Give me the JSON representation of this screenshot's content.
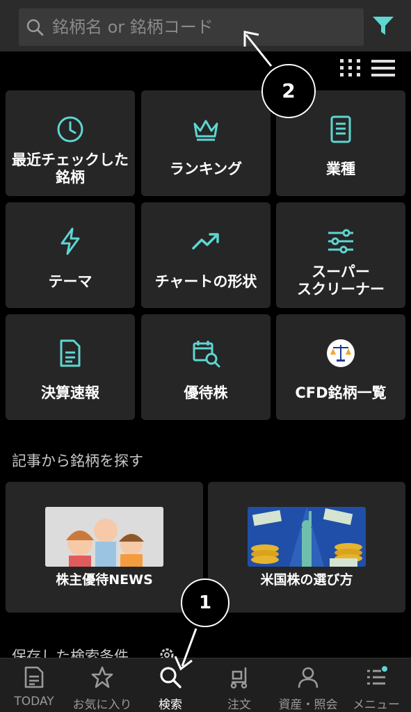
{
  "search": {
    "placeholder": "銘柄名 or 銘柄コード"
  },
  "tiles": [
    {
      "label": "最近チェックした\n銘柄",
      "icon": "clock-icon"
    },
    {
      "label": "ランキング",
      "icon": "crown-icon"
    },
    {
      "label": "業種",
      "icon": "document-icon"
    },
    {
      "label": "テーマ",
      "icon": "lightning-icon"
    },
    {
      "label": "チャートの形状",
      "icon": "trend-chart-icon"
    },
    {
      "label": "スーパー\nスクリーナー",
      "icon": "sliders-icon"
    },
    {
      "label": "決算速報",
      "icon": "report-icon"
    },
    {
      "label": "優待株",
      "icon": "calendar-search-icon"
    },
    {
      "label": "CFD銘柄一覧",
      "icon": "scale-icon"
    }
  ],
  "articles": {
    "section_title": "記事から銘柄を探す",
    "cards": [
      {
        "label": "株主優待NEWS"
      },
      {
        "label": "米国株の選び方"
      }
    ]
  },
  "saved_conditions": {
    "title": "保存した検索条件"
  },
  "bottom_nav": [
    {
      "label": "TODAY",
      "icon": "newspaper-icon"
    },
    {
      "label": "お気に入り",
      "icon": "star-icon"
    },
    {
      "label": "検索",
      "icon": "search-icon",
      "active": true
    },
    {
      "label": "注文",
      "icon": "cart-icon"
    },
    {
      "label": "資産・照会",
      "icon": "person-icon"
    },
    {
      "label": "メニュー",
      "icon": "menu-icon"
    }
  ],
  "annotations": {
    "callout_1": "1",
    "callout_2": "2"
  },
  "colors": {
    "accent": "#5ed6d2",
    "background": "#000000",
    "tile": "#262626",
    "header": "#2b2b2b"
  }
}
